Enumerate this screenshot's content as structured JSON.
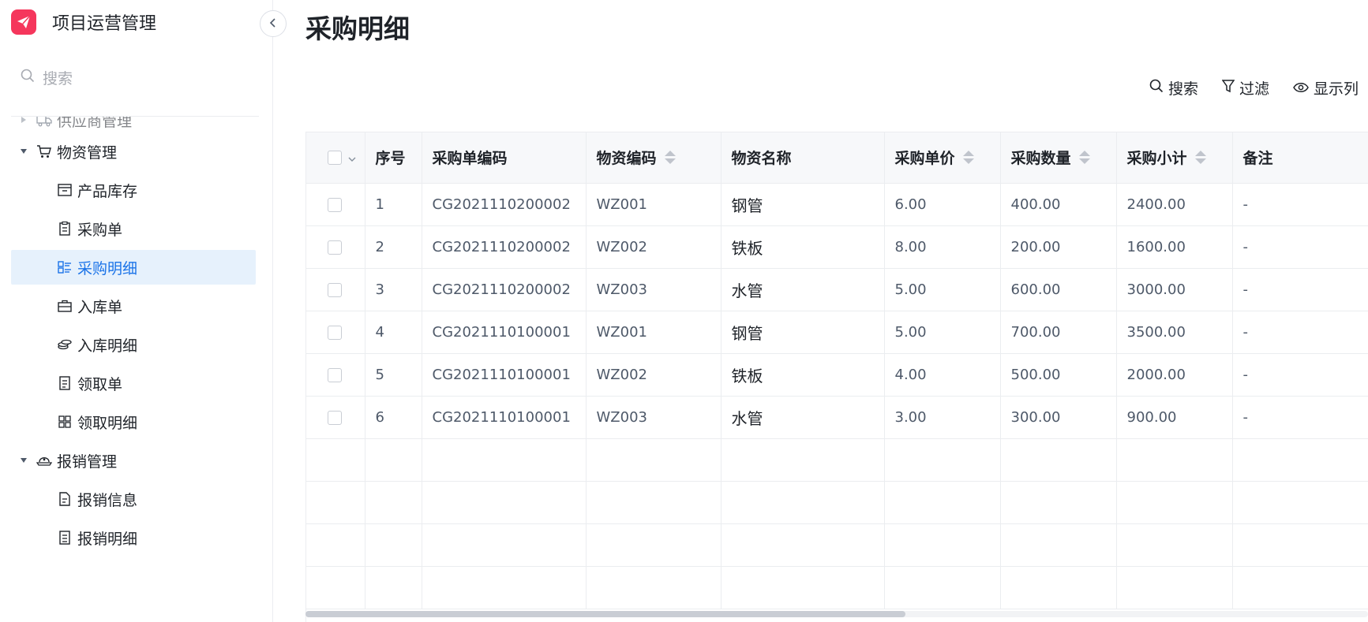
{
  "app": {
    "title": "项目运营管理"
  },
  "sidebar": {
    "search_placeholder": "搜索",
    "groups": [
      {
        "label": "供应商管理",
        "icon": "truck-icon"
      },
      {
        "label": "物资管理",
        "icon": "cart-icon",
        "items": [
          {
            "label": "产品库存",
            "icon": "inbox-icon"
          },
          {
            "label": "采购单",
            "icon": "clipboard-icon"
          },
          {
            "label": "采购明细",
            "icon": "list-icon",
            "active": true
          },
          {
            "label": "入库单",
            "icon": "briefcase-icon"
          },
          {
            "label": "入库明细",
            "icon": "coins-icon"
          },
          {
            "label": "领取单",
            "icon": "receipt-icon"
          },
          {
            "label": "领取明细",
            "icon": "grid-icon"
          }
        ]
      },
      {
        "label": "报销管理",
        "icon": "hat-icon",
        "items": [
          {
            "label": "报销信息",
            "icon": "file-icon"
          },
          {
            "label": "报销明细",
            "icon": "file-list-icon"
          }
        ]
      }
    ]
  },
  "main": {
    "title": "采购明细",
    "toolbar": {
      "search": "搜索",
      "filter": "过滤",
      "columns": "显示列"
    }
  },
  "table": {
    "columns": [
      "序号",
      "采购单编码",
      "物资编码",
      "物资名称",
      "采购单价",
      "采购数量",
      "采购小计",
      "备注"
    ],
    "rows": [
      {
        "index": "1",
        "order_code": "CG2021110200002",
        "material_code": "WZ001",
        "name": "钢管",
        "price": "6.00",
        "qty": "400.00",
        "subtotal": "2400.00",
        "note": "-"
      },
      {
        "index": "2",
        "order_code": "CG2021110200002",
        "material_code": "WZ002",
        "name": "铁板",
        "price": "8.00",
        "qty": "200.00",
        "subtotal": "1600.00",
        "note": "-"
      },
      {
        "index": "3",
        "order_code": "CG2021110200002",
        "material_code": "WZ003",
        "name": "水管",
        "price": "5.00",
        "qty": "600.00",
        "subtotal": "3000.00",
        "note": "-"
      },
      {
        "index": "4",
        "order_code": "CG2021110100001",
        "material_code": "WZ001",
        "name": "钢管",
        "price": "5.00",
        "qty": "700.00",
        "subtotal": "3500.00",
        "note": "-"
      },
      {
        "index": "5",
        "order_code": "CG2021110100001",
        "material_code": "WZ002",
        "name": "铁板",
        "price": "4.00",
        "qty": "500.00",
        "subtotal": "2000.00",
        "note": "-"
      },
      {
        "index": "6",
        "order_code": "CG2021110100001",
        "material_code": "WZ003",
        "name": "水管",
        "price": "3.00",
        "qty": "300.00",
        "subtotal": "900.00",
        "note": "-"
      }
    ]
  },
  "colors": {
    "brand": "#f5365c",
    "active_bg": "#e6f1fc",
    "active_text": "#1a73e8"
  }
}
